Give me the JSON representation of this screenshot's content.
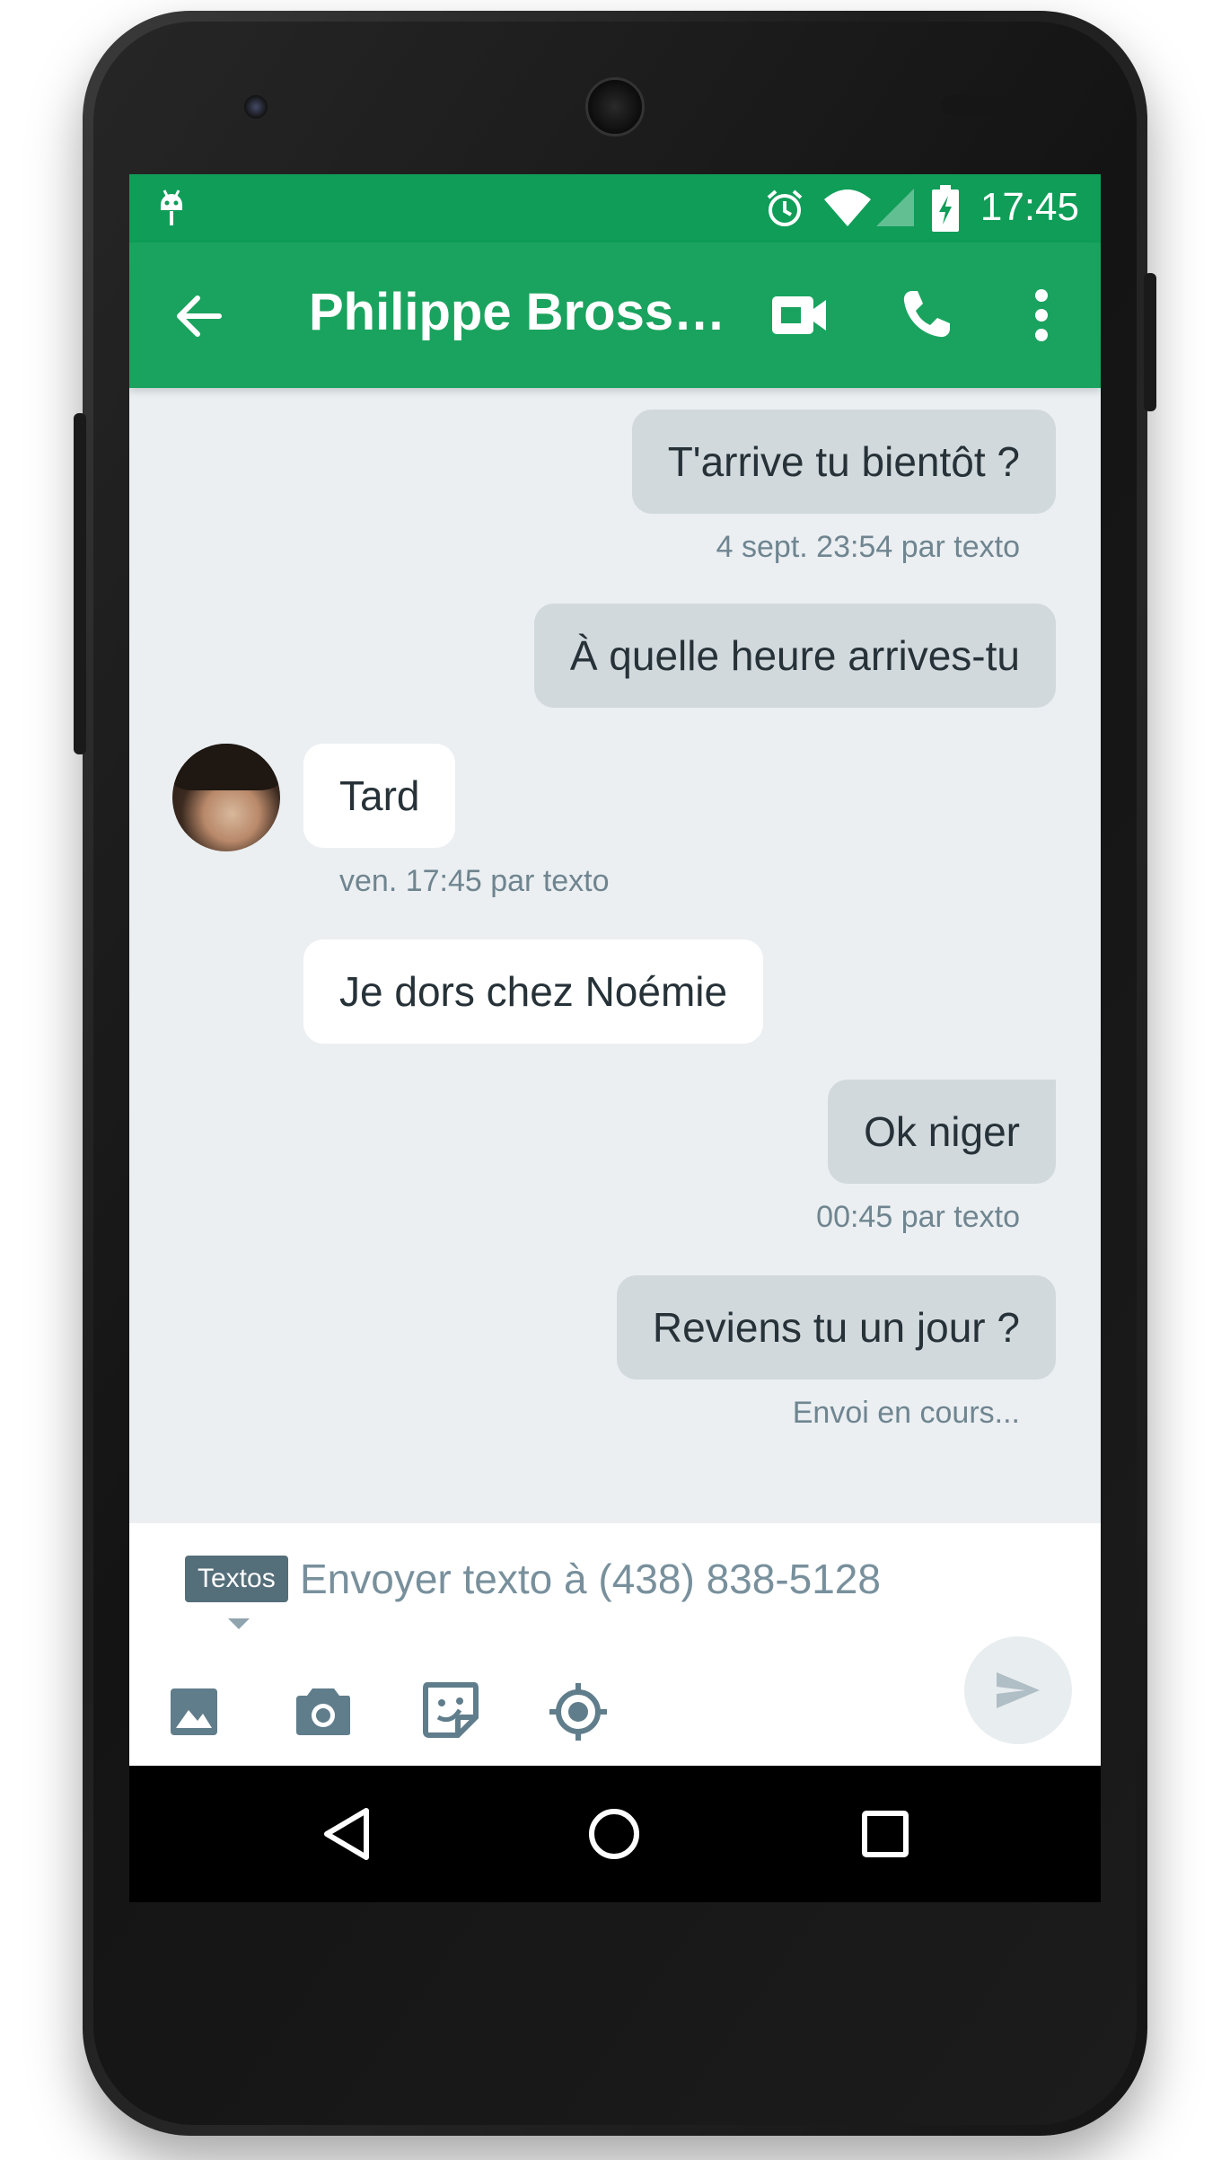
{
  "status_bar": {
    "time": "17:45",
    "icons": [
      "android-icon",
      "alarm-icon",
      "wifi-icon",
      "signal-icon",
      "battery-charging-icon"
    ]
  },
  "app_bar": {
    "title": "Philippe Brosse…",
    "actions": [
      "video-call-icon",
      "phone-icon",
      "more-vert-icon"
    ]
  },
  "messages": [
    {
      "direction": "out",
      "text": "T'arrive tu bientôt ?",
      "meta": "4 sept. 23:54 par texto"
    },
    {
      "direction": "out",
      "text": "À quelle heure arrives-tu",
      "meta": ""
    },
    {
      "direction": "in",
      "text": "Tard",
      "meta": "ven. 17:45 par texto"
    },
    {
      "direction": "in",
      "text": "Je dors chez Noémie",
      "meta": ""
    },
    {
      "direction": "out",
      "text": "Ok niger",
      "meta": "00:45 par texto"
    },
    {
      "direction": "out",
      "text": "Reviens tu un jour ?",
      "meta": "Envoi en cours..."
    }
  ],
  "composer": {
    "mode_label": "Textos",
    "placeholder": "Envoyer texto à (438) 838-5128",
    "value": "",
    "attachments": [
      "image-icon",
      "camera-icon",
      "sticker-icon",
      "location-icon"
    ]
  },
  "colors": {
    "primary": "#1aa35e",
    "status_bar": "#0f9d58",
    "background": "#ebeff2",
    "outgoing_bubble": "#d1d9dd",
    "incoming_bubble": "#ffffff"
  }
}
